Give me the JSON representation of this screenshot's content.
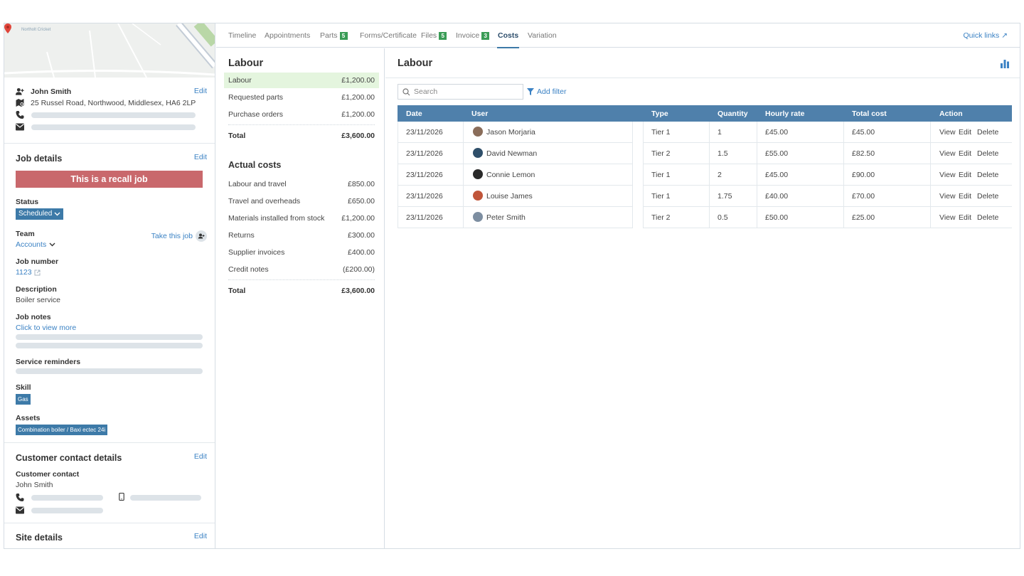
{
  "map": {
    "label": "Northolt Cricket"
  },
  "contact": {
    "name": "John Smith",
    "address": "25 Russel Road, Northwood, Middlesex, HA6 2LP",
    "edit": "Edit"
  },
  "job_details": {
    "title": "Job details",
    "edit": "Edit",
    "recall_banner": "This is a recall job",
    "status_label": "Status",
    "status_value": "Scheduled",
    "team_label": "Team",
    "team_value": "Accounts",
    "take_job": "Take this job",
    "job_number_label": "Job number",
    "job_number": "1123",
    "description_label": "Description",
    "description": "Boiler service",
    "job_notes_label": "Job notes",
    "job_notes_link": "Click to view more",
    "service_reminders_label": "Service reminders",
    "skill_label": "Skill",
    "skill_value": "Gas",
    "assets_label": "Assets",
    "assets_value": "Combination boiler / Baxi ectec 24i"
  },
  "customer_contact": {
    "title": "Customer contact details",
    "edit": "Edit",
    "label": "Customer contact",
    "name": "John Smith"
  },
  "site_details": {
    "title": "Site details",
    "edit": "Edit"
  },
  "tabs": [
    {
      "label": "Timeline"
    },
    {
      "label": "Appointments"
    },
    {
      "label": "Parts",
      "badge": "5"
    },
    {
      "label": "Forms/Certificate"
    },
    {
      "label": "Files",
      "badge": "5"
    },
    {
      "label": "Invoice",
      "badge": "3"
    },
    {
      "label": "Costs",
      "active": true
    },
    {
      "label": "Variation"
    }
  ],
  "quick_links": "Quick links ↗",
  "summary": {
    "title": "Labour",
    "rows": [
      {
        "label": "Labour",
        "value": "£1,200.00"
      },
      {
        "label": "Requested parts",
        "value": "£1,200.00"
      },
      {
        "label": "Purchase orders",
        "value": "£1,200.00"
      }
    ],
    "total_label": "Total",
    "total_value": "£3,600.00",
    "actual_title": "Actual costs",
    "actual_rows": [
      {
        "label": "Labour and travel",
        "value": "£850.00"
      },
      {
        "label": "Travel and overheads",
        "value": "£650.00"
      },
      {
        "label": "Materials installed from stock",
        "value": "£1,200.00"
      },
      {
        "label": "Returns",
        "value": "£300.00"
      },
      {
        "label": "Supplier invoices",
        "value": "£400.00"
      },
      {
        "label": "Credit notes",
        "value": "(£200.00)"
      }
    ],
    "actual_total_label": "Total",
    "actual_total_value": "£3,600.00"
  },
  "labour": {
    "title": "Labour",
    "search_placeholder": "Search",
    "add_filter": "Add filter",
    "columns": [
      "Date",
      "User",
      "Type",
      "Quantity",
      "Hourly rate",
      "Total cost",
      "Action"
    ],
    "rows": [
      {
        "date": "23/11/2026",
        "user": "Jason Morjaria",
        "type": "Tier 1",
        "quantity": "1",
        "rate": "£45.00",
        "total": "£45.00"
      },
      {
        "date": "23/11/2026",
        "user": "David Newman",
        "type": "Tier 2",
        "quantity": "1.5",
        "rate": "£55.00",
        "total": "£82.50"
      },
      {
        "date": "23/11/2026",
        "user": "Connie Lemon",
        "type": "Tier 1",
        "quantity": "2",
        "rate": "£45.00",
        "total": "£90.00"
      },
      {
        "date": "23/11/2026",
        "user": "Louise James",
        "type": "Tier 1",
        "quantity": "1.75",
        "rate": "£40.00",
        "total": "£70.00"
      },
      {
        "date": "23/11/2026",
        "user": "Peter Smith",
        "type": "Tier 2",
        "quantity": "0.5",
        "rate": "£50.00",
        "total": "£25.00"
      }
    ],
    "actions": {
      "view": "View",
      "edit": "Edit",
      "delete": "Delete"
    }
  },
  "colors": {
    "accent": "#3b82c4",
    "header_blue": "#4f80ab",
    "recall_red": "#c9686c",
    "badge_green": "#3a9c56",
    "highlight_green": "#e4f5de"
  }
}
